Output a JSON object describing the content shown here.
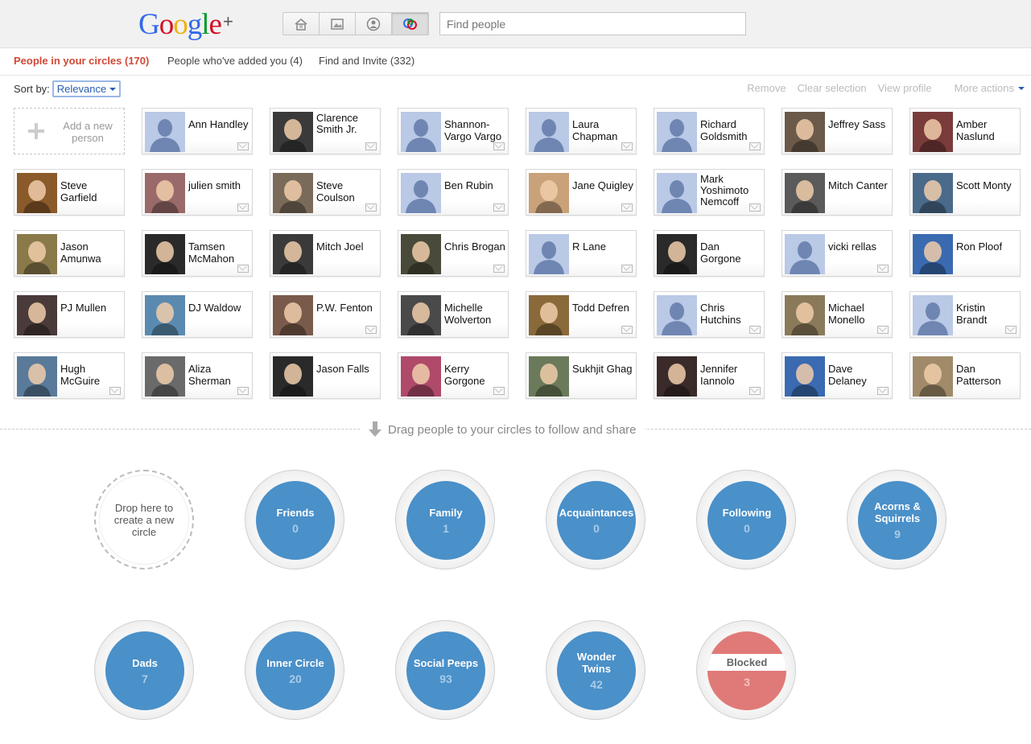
{
  "app": {
    "logo_text": "Google",
    "logo_plus": "+",
    "logo_colors": [
      "#3369e8",
      "#d50f25",
      "#eeb211",
      "#3369e8",
      "#009925",
      "#d50f25"
    ]
  },
  "nav": {
    "buttons": [
      {
        "name": "home",
        "icon": "home-icon"
      },
      {
        "name": "photos",
        "icon": "photos-icon"
      },
      {
        "name": "profile",
        "icon": "profile-icon"
      },
      {
        "name": "circles",
        "icon": "circles-icon",
        "active": true
      }
    ],
    "search_placeholder": "Find people"
  },
  "tabs": [
    {
      "label": "People in your circles (170)",
      "active": true
    },
    {
      "label": "People who've added you (4)",
      "active": false
    },
    {
      "label": "Find and Invite (332)",
      "active": false
    }
  ],
  "sort": {
    "label": "Sort by:",
    "value": "Relevance"
  },
  "actions": {
    "remove": "Remove",
    "clear": "Clear selection",
    "view_profile": "View profile",
    "more": "More actions"
  },
  "add_person": {
    "label": "Add a new person"
  },
  "people": [
    {
      "name": "Ann Handley",
      "photo": "default",
      "mail": true
    },
    {
      "name": "Clarence Smith Jr.",
      "photo": "#3a3a3a",
      "mail": true
    },
    {
      "name": "Shannon-Vargo Vargo",
      "photo": "default",
      "mail": true
    },
    {
      "name": "Laura Chapman",
      "photo": "default",
      "mail": true
    },
    {
      "name": "Richard Goldsmith",
      "photo": "default",
      "mail": true
    },
    {
      "name": "Jeffrey Sass",
      "photo": "#6b5a4a",
      "mail": false
    },
    {
      "name": "Amber Naslund",
      "photo": "#7a3b3b",
      "mail": false
    },
    {
      "name": "Steve Garfield",
      "photo": "#8a5a2a",
      "mail": false
    },
    {
      "name": "julien smith",
      "photo": "#9a6a6a",
      "mail": true
    },
    {
      "name": "Steve Coulson",
      "photo": "#7a6a5a",
      "mail": true
    },
    {
      "name": "Ben Rubin",
      "photo": "default",
      "mail": true
    },
    {
      "name": "Jane Quigley",
      "photo": "#c9a27a",
      "mail": true
    },
    {
      "name": "Mark Yoshimoto Nemcoff",
      "photo": "default",
      "mail": true
    },
    {
      "name": "Mitch Canter",
      "photo": "#5a5a5a",
      "mail": false
    },
    {
      "name": "Scott Monty",
      "photo": "#4a6a8a",
      "mail": false
    },
    {
      "name": "Jason Amunwa",
      "photo": "#8a7a4a",
      "mail": false
    },
    {
      "name": "Tamsen McMahon",
      "photo": "#2a2a2a",
      "mail": true
    },
    {
      "name": "Mitch Joel",
      "photo": "#3a3a3a",
      "mail": false
    },
    {
      "name": "Chris Brogan",
      "photo": "#4a4a3a",
      "mail": true
    },
    {
      "name": "R Lane",
      "photo": "default",
      "mail": true
    },
    {
      "name": "Dan Gorgone",
      "photo": "#2a2a2a",
      "mail": false
    },
    {
      "name": "vicki rellas",
      "photo": "default",
      "mail": true
    },
    {
      "name": "Ron Ploof",
      "photo": "#3a6ab0",
      "mail": false
    },
    {
      "name": "PJ Mullen",
      "photo": "#4a3a3a",
      "mail": false
    },
    {
      "name": "DJ Waldow",
      "photo": "#5a8ab0",
      "mail": false
    },
    {
      "name": "P.W. Fenton",
      "photo": "#7a5a4a",
      "mail": true
    },
    {
      "name": "Michelle Wolverton",
      "photo": "#4a4a4a",
      "mail": false
    },
    {
      "name": "Todd Defren",
      "photo": "#8a6a3a",
      "mail": true
    },
    {
      "name": "Chris Hutchins",
      "photo": "default",
      "mail": true
    },
    {
      "name": "Michael Monello",
      "photo": "#8a7a5a",
      "mail": true
    },
    {
      "name": "Kristin Brandt",
      "photo": "default",
      "mail": true
    },
    {
      "name": "Hugh McGuire",
      "photo": "#5a7a9a",
      "mail": true
    },
    {
      "name": "Aliza Sherman",
      "photo": "#6a6a6a",
      "mail": true
    },
    {
      "name": "Jason Falls",
      "photo": "#2a2a2a",
      "mail": false
    },
    {
      "name": "Kerry Gorgone",
      "photo": "#b04a6a",
      "mail": true
    },
    {
      "name": "Sukhjit Ghag",
      "photo": "#6a7a5a",
      "mail": false
    },
    {
      "name": "Jennifer Iannolo",
      "photo": "#3a2a2a",
      "mail": true
    },
    {
      "name": "Dave Delaney",
      "photo": "#3a6ab0",
      "mail": true
    },
    {
      "name": "Dan Patterson",
      "photo": "#a08a6a",
      "mail": false
    }
  ],
  "drag_hint": "Drag people to your circles to follow and share",
  "circles": [
    {
      "name": "Drop here to create a new circle",
      "count": "",
      "type": "new"
    },
    {
      "name": "Friends",
      "count": "0",
      "type": "normal"
    },
    {
      "name": "Family",
      "count": "1",
      "type": "normal"
    },
    {
      "name": "Acquaintances",
      "count": "0",
      "type": "normal"
    },
    {
      "name": "Following",
      "count": "0",
      "type": "normal"
    },
    {
      "name": "Acorns & Squirrels",
      "count": "9",
      "type": "normal"
    },
    {
      "name": "Dads",
      "count": "7",
      "type": "normal"
    },
    {
      "name": "Inner Circle",
      "count": "20",
      "type": "normal"
    },
    {
      "name": "Social Peeps",
      "count": "93",
      "type": "normal"
    },
    {
      "name": "Wonder Twins",
      "count": "42",
      "type": "normal"
    },
    {
      "name": "Blocked",
      "count": "3",
      "type": "blocked"
    }
  ]
}
